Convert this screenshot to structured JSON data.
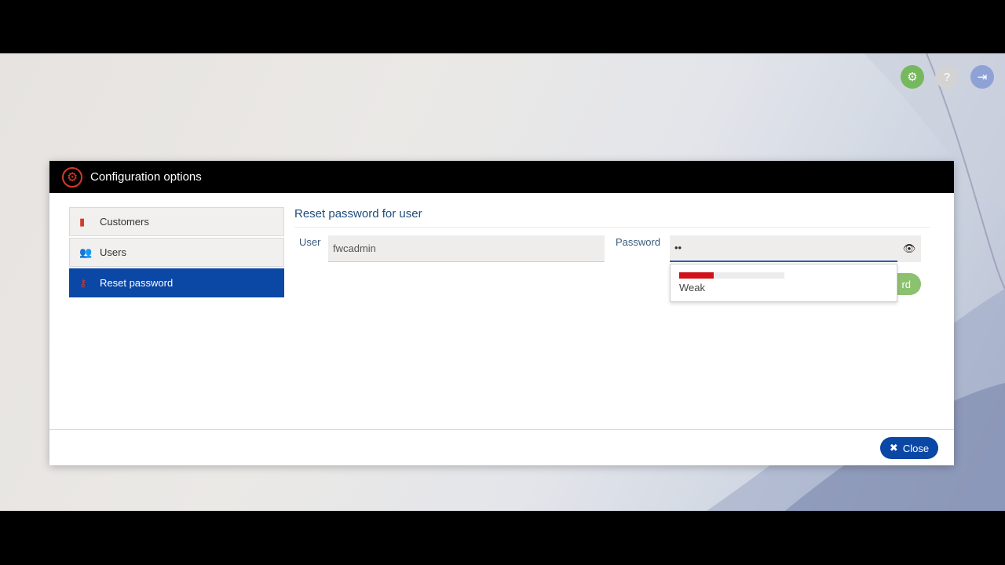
{
  "topbar": {
    "settings_icon": "gear-icon",
    "help_icon": "question-icon",
    "logout_icon": "logout-icon"
  },
  "modal": {
    "title": "Configuration options",
    "title_icon": "gear-icon",
    "close_label": "Close",
    "close_icon": "x-icon"
  },
  "sidebar": {
    "items": [
      {
        "label": "Customers",
        "icon": "building-icon",
        "active": false
      },
      {
        "label": "Users",
        "icon": "users-icon",
        "active": false
      },
      {
        "label": "Reset password",
        "icon": "key-icon",
        "active": true
      }
    ]
  },
  "form": {
    "section_title": "Reset password for user",
    "user_label": "User",
    "user_value": "fwcadmin",
    "password_label": "Password",
    "password_value": "••",
    "eye_icon": "eye-icon",
    "strength_label": "Weak",
    "strength_level": 0.33,
    "hidden_button_label_fragment": "rd"
  },
  "colors": {
    "accent": "#0b47a5",
    "brand_red": "#d33a2c",
    "success": "#76b85d",
    "weak": "#d0131b"
  }
}
